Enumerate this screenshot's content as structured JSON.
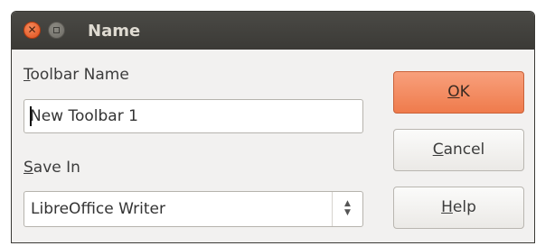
{
  "window": {
    "title": "Name"
  },
  "toolbar_name": {
    "label_mnemonic": "T",
    "label_rest": "oolbar Name",
    "value": "New Toolbar 1"
  },
  "save_in": {
    "label_mnemonic": "S",
    "label_rest": "ave In",
    "selected": "LibreOffice Writer"
  },
  "buttons": {
    "ok_mnemonic": "O",
    "ok_rest": "K",
    "cancel_mnemonic": "C",
    "cancel_rest": "ancel",
    "help_mnemonic": "H",
    "help_rest": "elp"
  },
  "icons": {
    "close": "close-icon",
    "minimize": "minimize-icon",
    "spin": "spin-arrows-icon"
  },
  "colors": {
    "accent": "#ef7b4c",
    "titlebar": "#3b3a36"
  }
}
